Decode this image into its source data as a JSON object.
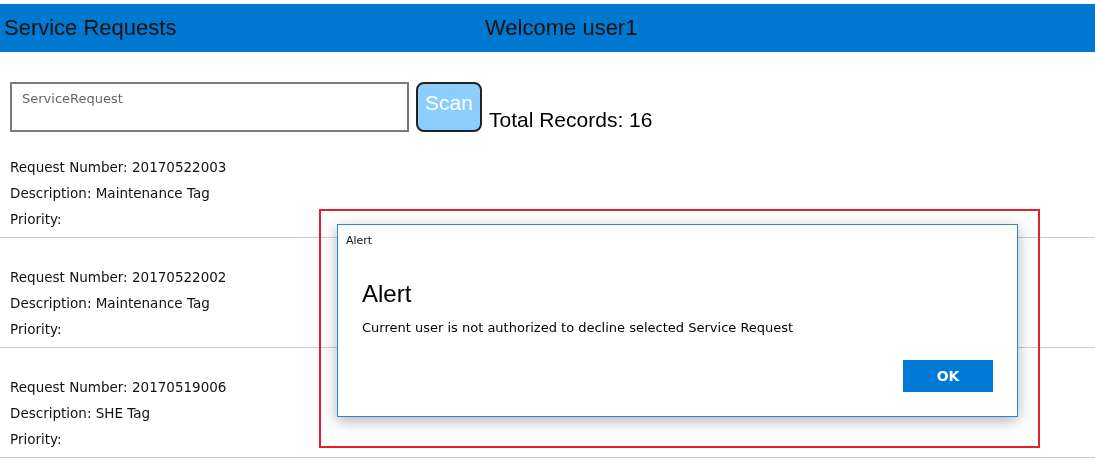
{
  "header": {
    "title": "Service Requests",
    "welcome": "Welcome user1"
  },
  "search": {
    "placeholder": "ServiceRequest"
  },
  "scan_button": "Scan",
  "total_records": "Total Records: 16",
  "records": [
    {
      "number": "Request Number: 20170522003",
      "description": "Description: Maintenance Tag",
      "priority": "Priority:"
    },
    {
      "number": "Request Number: 20170522002",
      "description": "Description: Maintenance Tag",
      "priority": "Priority:"
    },
    {
      "number": "Request Number: 20170519006",
      "description": "Description: SHE Tag",
      "priority": "Priority:"
    }
  ],
  "dialog": {
    "window_title": "Alert",
    "heading": "Alert",
    "message": "Current user is not authorized to decline selected Service Request",
    "button": "OK"
  }
}
